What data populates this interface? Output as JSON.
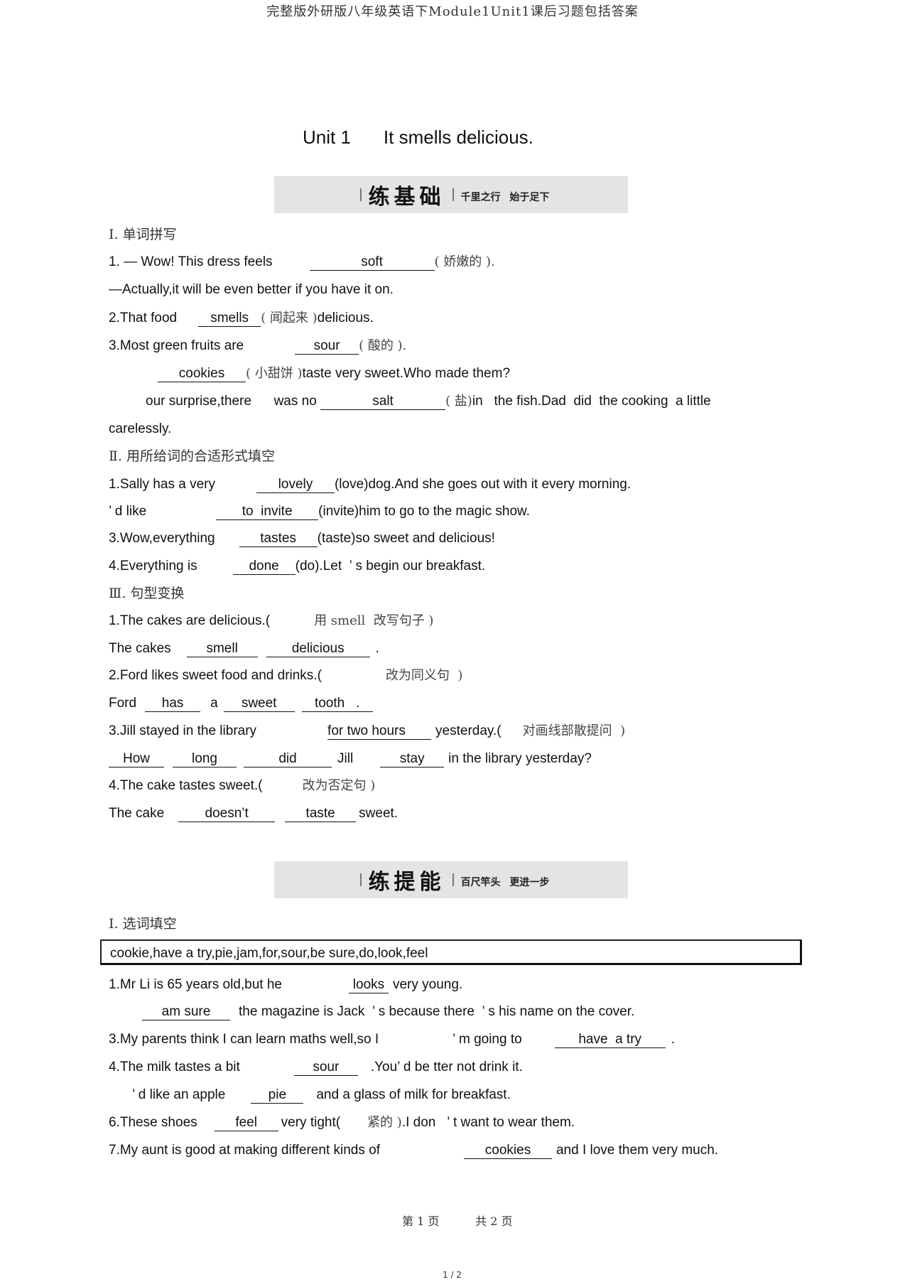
{
  "header_title": "完整版外研版八年级英语下Module1Unit1课后习题包括答案",
  "unit": {
    "label": "Unit 1",
    "title": "It smells delicious."
  },
  "band1": {
    "big": "练基础",
    "small": "千里之行 始于足下"
  },
  "band2": {
    "big": "练提能",
    "small": "百尺竿头 更进一步"
  },
  "part1": {
    "heading": "Ⅰ. 单词拼写",
    "q1a": {
      "pre": "1. — Wow! This dress feels",
      "answer": "soft",
      "hint": "( 娇嫩的 )."
    },
    "q1b": "—Actually,it will be even better if you have it on.",
    "q2": {
      "pre": "2.That food",
      "answer": "smells",
      "hint": "( 闻起来 )",
      "post": "delicious."
    },
    "q3": {
      "pre": "3.Most green fruits are",
      "answer": "sour",
      "hint": "( 酸的 )."
    },
    "q4": {
      "answer": "cookies",
      "hint": "( 小甜饼 )",
      "post": "taste very sweet.Who made them?"
    },
    "q5": {
      "pre": "our surprise,there      was no",
      "answer": "salt",
      "hint": "( 盐)",
      "post": "in   the fish.Dad  did  the cooking  a little"
    },
    "q5b": "carelessly."
  },
  "part2": {
    "heading": "Ⅱ. 用所给词的合适形式填空",
    "q1": {
      "pre": "1.Sally has a very",
      "answer": "lovely",
      "post": "(love)dog.And she goes out with it every morning."
    },
    "q2": {
      "pre": "’ d like",
      "answer": "to  invite",
      "post": "(invite)him to go to the magic show."
    },
    "q3": {
      "pre": "3.Wow,everything",
      "answer": "tastes",
      "post": "(taste)so sweet and delicious!"
    },
    "q4": {
      "pre": "4.Everything is",
      "answer": "done",
      "post": "(do).Let  ’ s begin our breakfast."
    }
  },
  "part3": {
    "heading": "Ⅲ. 句型变换",
    "q1": {
      "pre": "1.The cakes are delicious.(",
      "hint": "用 smell  改写句子 )"
    },
    "a1": {
      "pre": "The cakes",
      "answers": [
        "smell",
        "delicious"
      ],
      "post": "."
    },
    "q2": {
      "pre": "2.Ford likes sweet food and drinks.(",
      "hint": "改为同义句  )"
    },
    "a2": {
      "pre": "Ford",
      "answers": [
        "has",
        "sweet",
        "tooth"
      ],
      "mid": "a",
      "post": "."
    },
    "q3": {
      "pre": "3.Jill stayed in the library",
      "underlined": "for two hours",
      "post": "yesterday.(",
      "hint": "对画线部散提问  )"
    },
    "a3": {
      "answers": [
        "How",
        "long",
        "did",
        "stay"
      ],
      "mid": "Jill",
      "post": "in the library yesterday?"
    },
    "q4": {
      "pre": "4.The cake tastes sweet.(",
      "hint": "改为否定句 )"
    },
    "a4": {
      "pre": "The cake",
      "answers": [
        "doesn’t",
        "taste"
      ],
      "post": "sweet."
    }
  },
  "part4": {
    "heading": "Ⅰ. 选词填空",
    "word_box": "cookie,have a try,pie,jam,for,sour,be sure,do,look,feel",
    "q1": {
      "pre": "1.Mr Li is 65 years old,but he",
      "answer": "looks",
      "post": "very young."
    },
    "q2": {
      "answer": "am sure",
      "post": "the magazine is Jack  ’ s because there  ’ s his name on the cover."
    },
    "q3": {
      "pre": "3.My parents think I can learn maths well,so I",
      "mid": "’ m going to",
      "answer": "have  a try",
      "post": "."
    },
    "q4": {
      "pre": "4.The milk tastes a bit",
      "answer": "sour",
      "post": ".You’ d be tter not drink it."
    },
    "q5": {
      "pre": "’ d like an apple",
      "answer": "pie",
      "post": "and a glass of milk for breakfast."
    },
    "q6": {
      "pre": "6.These shoes",
      "answer": "feel",
      "post": "very tight(",
      "hint": "紧的 )",
      "post2": ".I don   ’ t want to wear them."
    },
    "q7": {
      "pre": "7.My aunt is good at making different kinds of",
      "answer": "cookies",
      "post": "and I love them very much."
    }
  },
  "footer": {
    "page": "第 1 页",
    "total": "共 2 页"
  },
  "page_indicator": "1 / 2"
}
